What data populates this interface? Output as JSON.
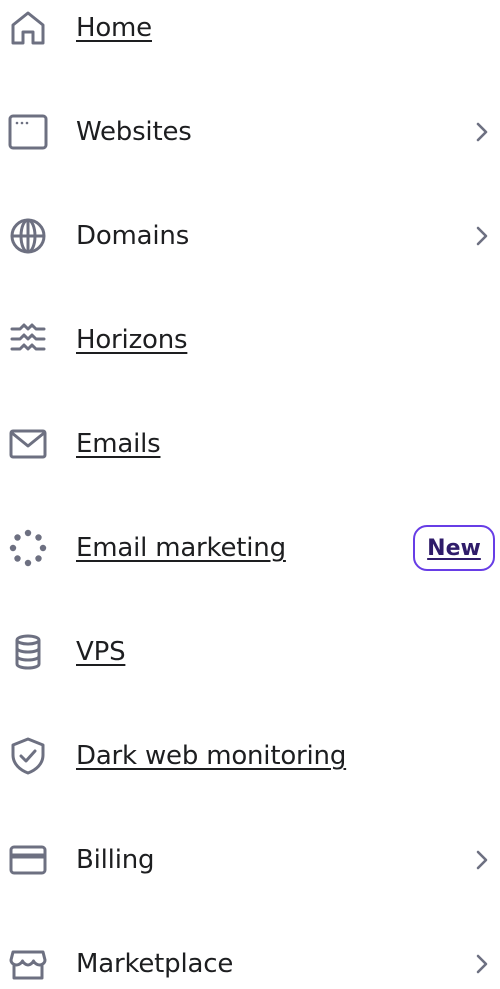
{
  "colors": {
    "icon": "#6d7081",
    "text": "#1d1e20",
    "badge_border": "#673de6",
    "badge_text": "#2f1c6a"
  },
  "menu": {
    "items": [
      {
        "label": "Home",
        "icon": "home-icon",
        "has_submenu": false
      },
      {
        "label": "Websites",
        "icon": "browser-window-icon",
        "has_submenu": true
      },
      {
        "label": "Domains",
        "icon": "globe-icon",
        "has_submenu": true
      },
      {
        "label": "Horizons",
        "icon": "horizons-waves-icon",
        "has_submenu": false
      },
      {
        "label": "Emails",
        "icon": "envelope-icon",
        "has_submenu": false
      },
      {
        "label": "Email marketing",
        "icon": "email-marketing-spinner-icon",
        "has_submenu": false,
        "badge": "New"
      },
      {
        "label": "VPS",
        "icon": "database-icon",
        "has_submenu": false
      },
      {
        "label": "Dark web monitoring",
        "icon": "shield-check-icon",
        "has_submenu": false
      },
      {
        "label": "Billing",
        "icon": "credit-card-icon",
        "has_submenu": true
      },
      {
        "label": "Marketplace",
        "icon": "storefront-icon",
        "has_submenu": true
      }
    ]
  }
}
